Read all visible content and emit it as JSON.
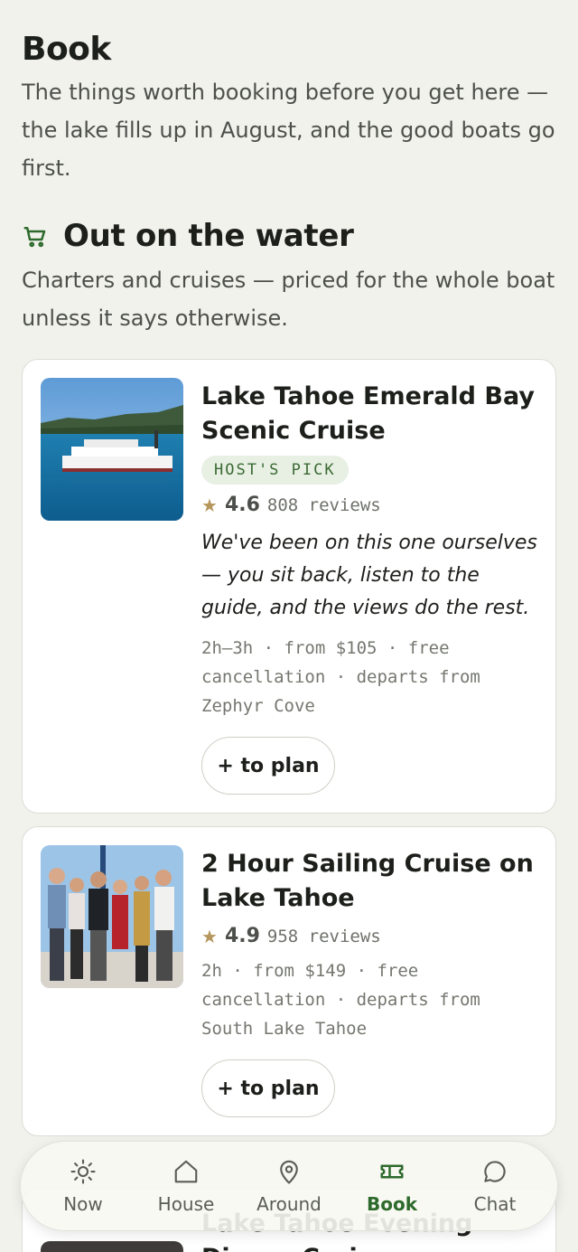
{
  "header": {
    "title": "Book",
    "intro": "The things worth booking before you get here — the lake fills up in August, and the good boats go first."
  },
  "section": {
    "icon": "cart-icon",
    "title": "Out on the water",
    "subtitle": "Charters and cruises — priced for the whole boat unless it says otherwise."
  },
  "cards": [
    {
      "title": "Lake Tahoe Emerald Bay Scenic Cruise",
      "badge": "HOST'S PICK",
      "rating": "4.6",
      "reviews": "808 reviews",
      "quote": "We've been on this one ourselves — you sit back, listen to the guide, and the views do the rest.",
      "meta": "2h–3h · from $105 · free cancellation · departs from Zephyr Cove",
      "button": "+ to plan"
    },
    {
      "title": "2 Hour Sailing Cruise on Lake Tahoe",
      "rating": "4.9",
      "reviews": "958 reviews",
      "meta": "2h · from $149 · free cancellation · departs from South Lake Tahoe",
      "button": "+ to plan"
    },
    {
      "title_visible": "Lake Tahoe Evening Dinner Cruise"
    }
  ],
  "nav": {
    "items": [
      {
        "label": "Now",
        "icon": "sun-icon"
      },
      {
        "label": "House",
        "icon": "house-icon"
      },
      {
        "label": "Around",
        "icon": "map-pin-icon"
      },
      {
        "label": "Book",
        "icon": "ticket-icon",
        "active": true
      },
      {
        "label": "Chat",
        "icon": "chat-bubble-icon"
      }
    ]
  },
  "colors": {
    "background": "#f2f2ed",
    "accent_green": "#2e6a2c",
    "badge_bg": "#e7f0e3",
    "star": "#b5965c"
  }
}
